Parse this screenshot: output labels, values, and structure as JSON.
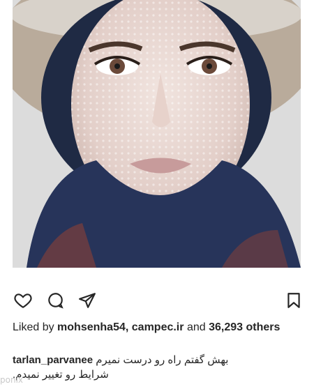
{
  "post": {
    "image": {
      "description": ""
    },
    "actions": {
      "like_icon": "heart-icon",
      "comment_icon": "comment-icon",
      "share_icon": "send-icon",
      "save_icon": "bookmark-icon"
    },
    "likes": {
      "prefix": "Liked by",
      "user1": "mohsenha54,",
      "user2": "campec.ir",
      "conj": "and",
      "count": "36,293",
      "others": "others"
    },
    "caption": {
      "username": "tarlan_parvanee",
      "line1": "بهش گفتم راه رو درست نمیرم",
      "line2": "شرایط رو تغییر نمیدم."
    }
  },
  "watermark": "ponix"
}
